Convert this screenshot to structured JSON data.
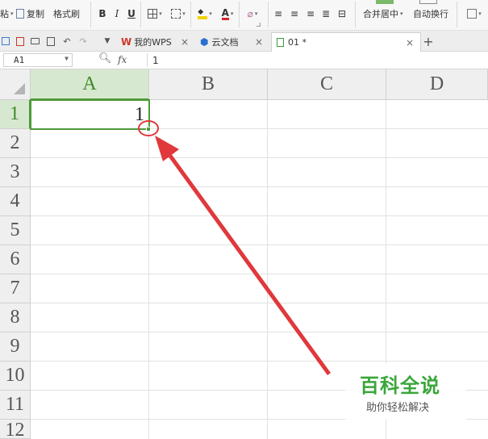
{
  "ribbon": {
    "copy_label": "复制",
    "format_painter_label": "格式刷",
    "bold": "B",
    "italic": "I",
    "underline": "U",
    "merge_center_label": "合并居中",
    "wrap_text_label": "自动换行"
  },
  "tabs": [
    {
      "label": "我的WPS",
      "icon": "wps-logo-icon",
      "color": "#d0372b"
    },
    {
      "label": "云文档",
      "icon": "cloud-doc-icon",
      "color": "#2b6fd0"
    },
    {
      "label": "01 *",
      "icon": "sheet-file-icon",
      "color": "#3a9a3a"
    }
  ],
  "formula_bar": {
    "cell_ref": "A1",
    "fx_label": "fx",
    "value": "1"
  },
  "sheet": {
    "columns": [
      "A",
      "B",
      "C",
      "D"
    ],
    "rows": [
      "1",
      "2",
      "3",
      "4",
      "5",
      "6",
      "7",
      "8",
      "9",
      "10",
      "11",
      "12"
    ],
    "cell_a1": "1",
    "selected_cell": "A1"
  },
  "watermark": {
    "title": "百科全说",
    "subtitle": "助你轻松解决"
  },
  "colors": {
    "accent_green": "#4e9a3a",
    "annotation_red": "#e0383b"
  }
}
